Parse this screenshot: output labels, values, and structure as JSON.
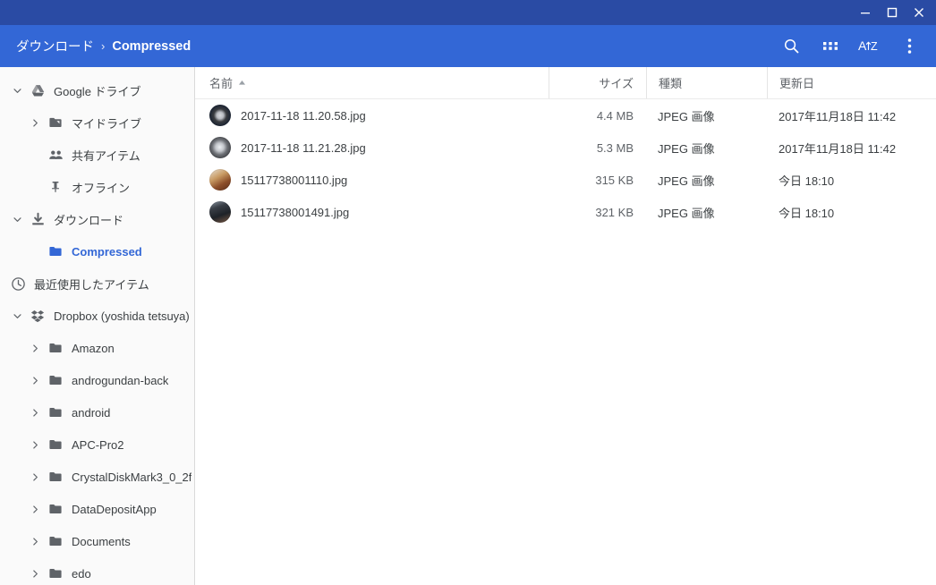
{
  "window": {
    "controls": [
      {
        "name": "minimize",
        "glyph": "minimize-icon"
      },
      {
        "name": "maximize",
        "glyph": "maximize-icon"
      },
      {
        "name": "close",
        "glyph": "close-icon"
      }
    ]
  },
  "toolbar": {
    "breadcrumb": [
      {
        "label": "ダウンロード",
        "current": false
      },
      {
        "label": "Compressed",
        "current": true
      }
    ],
    "separator": "›",
    "buttons": [
      {
        "name": "search-icon",
        "label": ""
      },
      {
        "name": "grid-view-icon",
        "label": ""
      },
      {
        "name": "sort-az-icon",
        "label": "AZ"
      },
      {
        "name": "more-options-icon",
        "label": ""
      }
    ],
    "accent_color": "#3367d6",
    "titlebar_color": "#2a4ba4"
  },
  "sidebar": {
    "items": [
      {
        "label": "Google ドライブ",
        "icon": "google-drive-icon",
        "level": 0,
        "twisty": "down",
        "selected": false
      },
      {
        "label": "マイドライブ",
        "icon": "my-drive-icon",
        "level": 1,
        "twisty": "right",
        "selected": false
      },
      {
        "label": "共有アイテム",
        "icon": "shared-items-icon",
        "level": 1,
        "twisty": "none",
        "selected": false
      },
      {
        "label": "オフライン",
        "icon": "offline-pin-icon",
        "level": 1,
        "twisty": "none",
        "selected": false
      },
      {
        "label": "ダウンロード",
        "icon": "download-icon",
        "level": 0,
        "twisty": "down",
        "selected": false
      },
      {
        "label": "Compressed",
        "icon": "folder-icon",
        "level": 1,
        "twisty": "none",
        "selected": true
      },
      {
        "label": "最近使用したアイテム",
        "icon": "recent-clock-icon",
        "level": 0,
        "twisty": "none",
        "selected": false
      },
      {
        "label": "Dropbox (yoshida tetsuya)",
        "icon": "dropbox-icon",
        "level": 0,
        "twisty": "down",
        "selected": false
      },
      {
        "label": "Amazon",
        "icon": "folder-icon",
        "level": 1,
        "twisty": "right",
        "selected": false
      },
      {
        "label": "androgundan-back",
        "icon": "folder-icon",
        "level": 1,
        "twisty": "right",
        "selected": false
      },
      {
        "label": "android",
        "icon": "folder-icon",
        "level": 1,
        "twisty": "right",
        "selected": false
      },
      {
        "label": "APC-Pro2",
        "icon": "folder-icon",
        "level": 1,
        "twisty": "right",
        "selected": false
      },
      {
        "label": "CrystalDiskMark3_0_2f",
        "icon": "folder-icon",
        "level": 1,
        "twisty": "right",
        "selected": false
      },
      {
        "label": "DataDepositApp",
        "icon": "folder-icon",
        "level": 1,
        "twisty": "right",
        "selected": false
      },
      {
        "label": "Documents",
        "icon": "folder-icon",
        "level": 1,
        "twisty": "right",
        "selected": false
      },
      {
        "label": "edo",
        "icon": "folder-icon",
        "level": 1,
        "twisty": "right",
        "selected": false
      }
    ]
  },
  "file_list": {
    "columns": [
      {
        "key": "name",
        "label": "名前",
        "sorted": "asc"
      },
      {
        "key": "size",
        "label": "サイズ",
        "sorted": "none"
      },
      {
        "key": "type",
        "label": "種類",
        "sorted": "none"
      },
      {
        "key": "date",
        "label": "更新日",
        "sorted": "none"
      }
    ],
    "rows": [
      {
        "name": "2017-11-18 11.20.58.jpg",
        "size": "4.4 MB",
        "type": "JPEG 画像",
        "date": "2017年11月18日 11:42",
        "thumb": "tire-dark"
      },
      {
        "name": "2017-11-18 11.21.28.jpg",
        "size": "5.3 MB",
        "type": "JPEG 画像",
        "date": "2017年11月18日 11:42",
        "thumb": "wheel-silver"
      },
      {
        "name": "15117738001110.jpg",
        "size": "315 KB",
        "type": "JPEG 画像",
        "date": "今日 18:10",
        "thumb": "warm-scene"
      },
      {
        "name": "15117738001491.jpg",
        "size": "321 KB",
        "type": "JPEG 画像",
        "date": "今日 18:10",
        "thumb": "keypad-dark"
      }
    ]
  }
}
